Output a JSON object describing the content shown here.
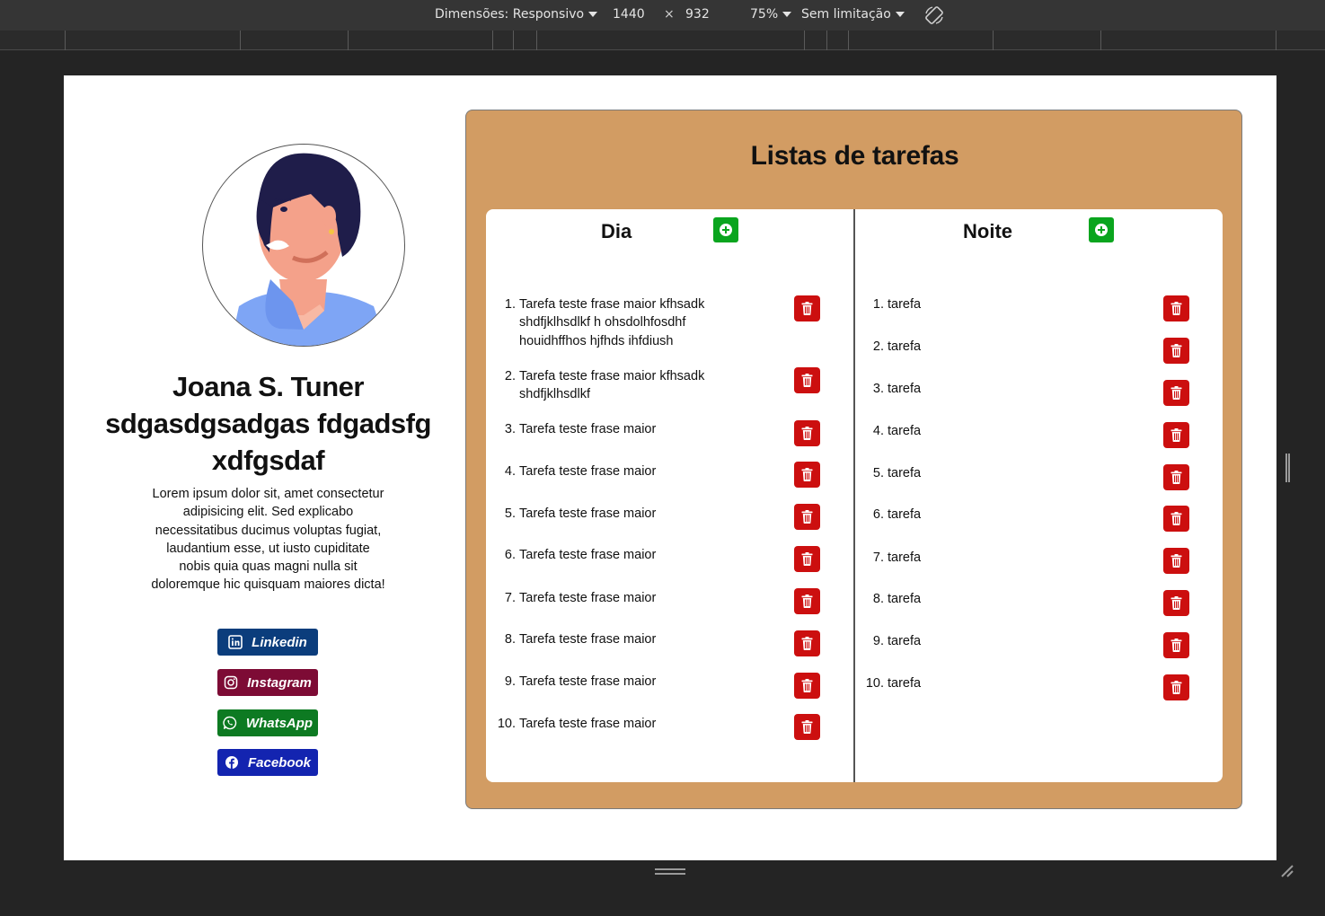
{
  "devtools": {
    "dimensions_label": "Dimensões: Responsivo",
    "width": "1440",
    "times": "×",
    "height": "932",
    "zoom": "75%",
    "throttle": "Sem limitação"
  },
  "profile": {
    "name": "Joana S. Tuner sdgasdgsadgas fdgadsfg xdfgsdaf",
    "bio": "Lorem ipsum dolor sit, amet consectetur adipisicing elit. Sed explicabo necessitatibus ducimus voluptas fugiat, laudantium esse, ut iusto cupiditate nobis quia quas magni nulla sit doloremque hic quisquam maiores dicta!",
    "socials": {
      "linkedin": "Linkedin",
      "instagram": "Instagram",
      "whatsapp": "WhatsApp",
      "facebook": "Facebook"
    }
  },
  "tasks": {
    "title": "Listas de tarefas",
    "day": {
      "title": "Dia",
      "items": [
        "Tarefa teste frase maior kfhsadk shdfjklhsdlkf h ohsdolhfosdhf houidhffhos hjfhds ihfdiush",
        "Tarefa teste frase maior kfhsadk shdfjklhsdlkf",
        "Tarefa teste frase maior",
        "Tarefa teste frase maior",
        "Tarefa teste frase maior",
        "Tarefa teste frase maior",
        "Tarefa teste frase maior",
        "Tarefa teste frase maior",
        "Tarefa teste frase maior",
        "Tarefa teste frase maior"
      ]
    },
    "night": {
      "title": "Noite",
      "items": [
        "tarefa",
        "tarefa",
        "tarefa",
        "tarefa",
        "tarefa",
        "tarefa",
        "tarefa",
        "tarefa",
        "tarefa",
        "tarefa"
      ]
    }
  },
  "colors": {
    "panel": "#d29c63",
    "add": "#0aa51e",
    "delete": "#cc0f0f",
    "linkedin": "#0b3d7c",
    "instagram": "#7d0b35",
    "whatsapp": "#0d7a22",
    "facebook": "#1324b0"
  }
}
